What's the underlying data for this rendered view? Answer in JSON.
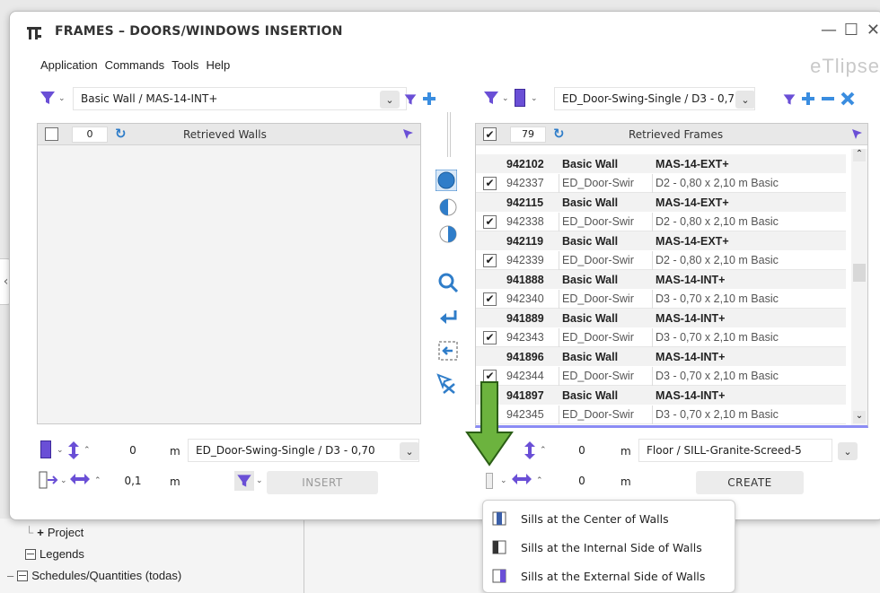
{
  "window": {
    "title": "FRAMES – DOORS/WINDOWS INSERTION",
    "controls": [
      "—",
      "☐",
      "✕"
    ],
    "brand": "eTlipse"
  },
  "menu": [
    "Application",
    "Commands",
    "Tools",
    "Help"
  ],
  "left": {
    "filter_value": "Basic Wall / MAS-14-INT+",
    "count": "0",
    "title": "Retrieved Walls",
    "elevation": "0",
    "elevation_unit": "m",
    "family_type": "ED_Door-Swing-Single / D3 - 0,70",
    "offset": "0,1",
    "offset_unit": "m",
    "insert_label": "INSERT"
  },
  "right": {
    "filter_value": "ED_Door-Swing-Single / D3 - 0,7",
    "count": "79",
    "title": "Retrieved Frames",
    "rows": [
      {
        "kind": "parent",
        "id": "942102",
        "name": "Basic Wall",
        "type": "MAS-14-EXT+"
      },
      {
        "kind": "child",
        "checked": true,
        "id": "942337",
        "name": "ED_Door-Swir",
        "type": "D2 - 0,80 x 2,10 m Basic"
      },
      {
        "kind": "parent",
        "id": "942115",
        "name": "Basic Wall",
        "type": "MAS-14-EXT+"
      },
      {
        "kind": "child",
        "checked": true,
        "id": "942338",
        "name": "ED_Door-Swir",
        "type": "D2 - 0,80 x 2,10 m Basic"
      },
      {
        "kind": "parent",
        "id": "942119",
        "name": "Basic Wall",
        "type": "MAS-14-EXT+"
      },
      {
        "kind": "child",
        "checked": true,
        "id": "942339",
        "name": "ED_Door-Swir",
        "type": "D2 - 0,80 x 2,10 m Basic"
      },
      {
        "kind": "parent",
        "id": "941888",
        "name": "Basic Wall",
        "type": "MAS-14-INT+"
      },
      {
        "kind": "child",
        "checked": true,
        "id": "942340",
        "name": "ED_Door-Swir",
        "type": "D3 - 0,70 x 2,10 m Basic"
      },
      {
        "kind": "parent",
        "id": "941889",
        "name": "Basic Wall",
        "type": "MAS-14-INT+"
      },
      {
        "kind": "child",
        "checked": true,
        "id": "942343",
        "name": "ED_Door-Swir",
        "type": "D3 - 0,70 x 2,10 m Basic"
      },
      {
        "kind": "parent",
        "id": "941896",
        "name": "Basic Wall",
        "type": "MAS-14-INT+"
      },
      {
        "kind": "child",
        "checked": true,
        "id": "942344",
        "name": "ED_Door-Swir",
        "type": "D3 - 0,70 x 2,10 m Basic"
      },
      {
        "kind": "parent",
        "id": "941897",
        "name": "Basic Wall",
        "type": "MAS-14-INT+"
      },
      {
        "kind": "child",
        "checked": true,
        "id": "942345",
        "name": "ED_Door-Swir",
        "type": "D3 - 0,70 x 2,10 m Basic"
      }
    ],
    "elevation": "0",
    "elevation_unit": "m",
    "family_type": "Floor / SILL-Granite-Screed-5",
    "offset": "0",
    "offset_unit": "m",
    "create_label": "CREATE"
  },
  "sill_menu": [
    "Sills at the Center of Walls",
    "Sills at the Internal Side of Walls",
    "Sills at the External Side of Walls"
  ],
  "project_tree": {
    "project": "Project",
    "legends": "Legends",
    "schedules": "Schedules/Quantities (todas)"
  },
  "colors": {
    "accent_purple": "#6a4fd6",
    "accent_blue": "#2f7dc9",
    "arrow_green": "#6cb33e",
    "plus_blue": "#3a8de0"
  }
}
